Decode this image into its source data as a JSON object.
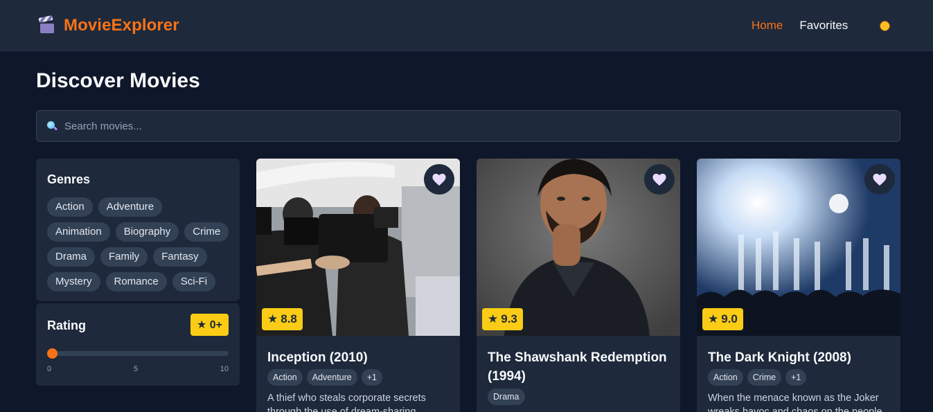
{
  "app": {
    "name": "MovieExplorer"
  },
  "nav": {
    "home": "Home",
    "favorites": "Favorites"
  },
  "page": {
    "title": "Discover Movies"
  },
  "search": {
    "placeholder": "Search movies..."
  },
  "filters": {
    "genres_title": "Genres",
    "genres": [
      "Action",
      "Adventure",
      "Animation",
      "Biography",
      "Crime",
      "Drama",
      "Family",
      "Fantasy",
      "Mystery",
      "Romance",
      "Sci-Fi"
    ],
    "rating_title": "Rating",
    "rating_badge": "★ 0+",
    "rating_value": 0,
    "rating_min_label": "0",
    "rating_mid_label": "5",
    "rating_max_label": "10"
  },
  "movies": [
    {
      "title": "Inception (2010)",
      "rating": "8.8",
      "tags": [
        "Action",
        "Adventure",
        "+1"
      ],
      "description": "A thief who steals corporate secrets through the use of dream-sharing"
    },
    {
      "title": "The Shawshank Redemption (1994)",
      "rating": "9.3",
      "tags": [
        "Drama"
      ],
      "description": ""
    },
    {
      "title": "The Dark Knight (2008)",
      "rating": "9.0",
      "tags": [
        "Action",
        "Crime",
        "+1"
      ],
      "description": "When the menace known as the Joker wreaks havoc and chaos on the people"
    }
  ],
  "colors": {
    "accent": "#f97316",
    "rating": "#facc15",
    "background": "#0f172a",
    "surface": "#1e293b"
  }
}
